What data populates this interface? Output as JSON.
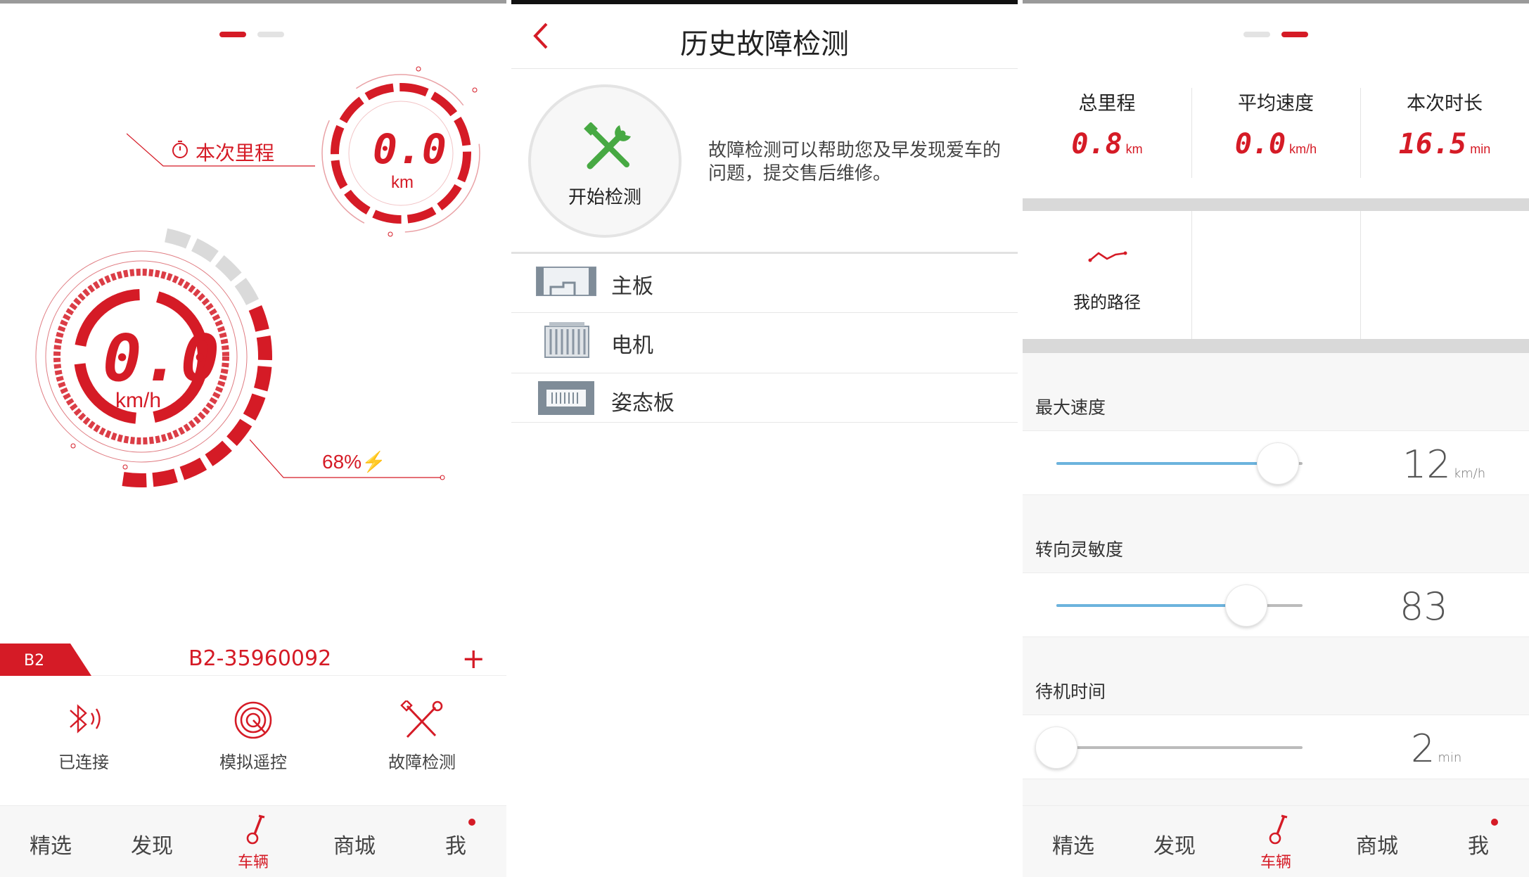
{
  "theme": {
    "accent": "#d51b26",
    "slider_fill": "#6cb3dd",
    "slider_track": "#bbbbbb"
  },
  "home": {
    "trip_label": "本次里程",
    "trip_value": "0.0",
    "trip_unit": "km",
    "speed_value": "0.0",
    "speed_unit": "km/h",
    "battery_percent": 68,
    "battery_text": "68%",
    "vehicle_tag": "B2",
    "vehicle_id": "B2-35960092",
    "add_icon": "plus-icon",
    "actions": [
      {
        "label": "已连接",
        "icon": "bluetooth-icon"
      },
      {
        "label": "模拟遥控",
        "icon": "remote-control-icon"
      },
      {
        "label": "故障检测",
        "icon": "tools-icon"
      }
    ]
  },
  "diagnosis": {
    "title": "历史故障检测",
    "back_icon": "back-arrow-icon",
    "start_label": "开始检测",
    "start_icon": "wrench-screwdriver-icon",
    "description": "故障检测可以帮助您及早发现爱车的问题，提交售后维修。",
    "parts": [
      {
        "label": "主板",
        "icon": "mainboard-icon"
      },
      {
        "label": "电机",
        "icon": "motor-icon"
      },
      {
        "label": "姿态板",
        "icon": "attitude-board-icon"
      }
    ]
  },
  "stats": {
    "items": [
      {
        "label": "总里程",
        "value": "0.8",
        "unit": "km"
      },
      {
        "label": "平均速度",
        "value": "0.0",
        "unit": "km/h"
      },
      {
        "label": "本次时长",
        "value": "16.5",
        "unit": "min"
      }
    ],
    "route_label": "我的路径",
    "route_icon": "route-icon"
  },
  "settings": [
    {
      "title": "最大速度",
      "value": "12",
      "unit": "km/h",
      "fraction": 0.9
    },
    {
      "title": "转向灵敏度",
      "value": "83",
      "unit": "",
      "fraction": 0.77
    },
    {
      "title": "待机时间",
      "value": "2",
      "unit": "min",
      "fraction": 0.0
    }
  ],
  "tabs": [
    {
      "label": "精选"
    },
    {
      "label": "发现"
    },
    {
      "label": "车辆",
      "icon": "scooter-icon",
      "active": true
    },
    {
      "label": "商城"
    },
    {
      "label": "我",
      "badge": true
    }
  ]
}
